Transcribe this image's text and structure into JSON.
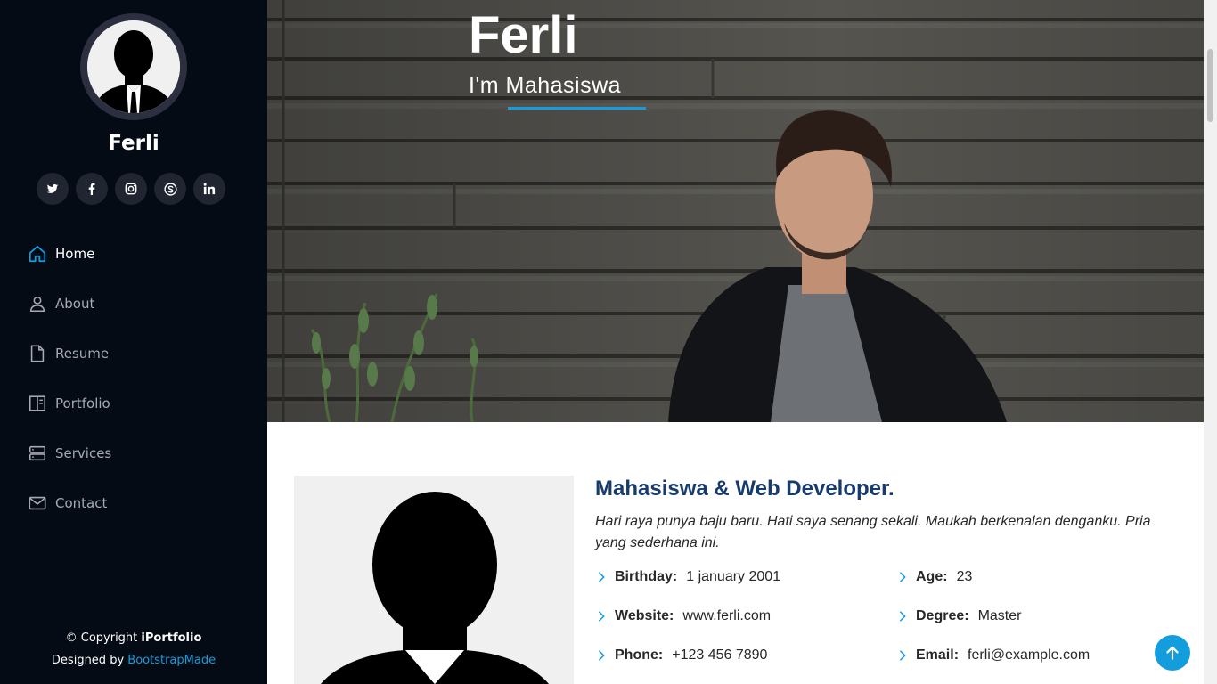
{
  "sidebar": {
    "name": "Ferli",
    "socials": [
      {
        "icon": "twitter-icon"
      },
      {
        "icon": "facebook-icon"
      },
      {
        "icon": "instagram-icon"
      },
      {
        "icon": "skype-icon"
      },
      {
        "icon": "linkedin-icon"
      }
    ],
    "nav": [
      {
        "label": "Home",
        "icon": "house-icon",
        "active": true
      },
      {
        "label": "About",
        "icon": "person-icon"
      },
      {
        "label": "Resume",
        "icon": "file-icon"
      },
      {
        "label": "Portfolio",
        "icon": "book-half-icon"
      },
      {
        "label": "Services",
        "icon": "server-icon"
      },
      {
        "label": "Contact",
        "icon": "envelope-icon"
      }
    ],
    "footer": {
      "copyright_prefix": "© Copyright ",
      "brand": "iPortfolio",
      "designed_prefix": "Designed by ",
      "designer": "BootstrapMade"
    }
  },
  "hero": {
    "title": "Ferli",
    "subtitle": "I'm Mahasiswa"
  },
  "about": {
    "heading": "Mahasiswa & Web Developer.",
    "description": "Hari raya punya baju baru. Hati saya senang sekali. Maukah berkenalan denganku. Pria yang sederhana ini.",
    "info": [
      {
        "label": "Birthday:",
        "value": "1 january 2001"
      },
      {
        "label": "Age:",
        "value": "23"
      },
      {
        "label": "Website:",
        "value": "www.ferli.com"
      },
      {
        "label": "Degree:",
        "value": "Master"
      },
      {
        "label": "Phone:",
        "value": "+123 456 7890"
      },
      {
        "label": "Email:",
        "value": "ferli@example.com"
      }
    ]
  },
  "colors": {
    "accent": "#149ddd",
    "sidebar_bg": "#040b14",
    "heading": "#173b6c"
  }
}
